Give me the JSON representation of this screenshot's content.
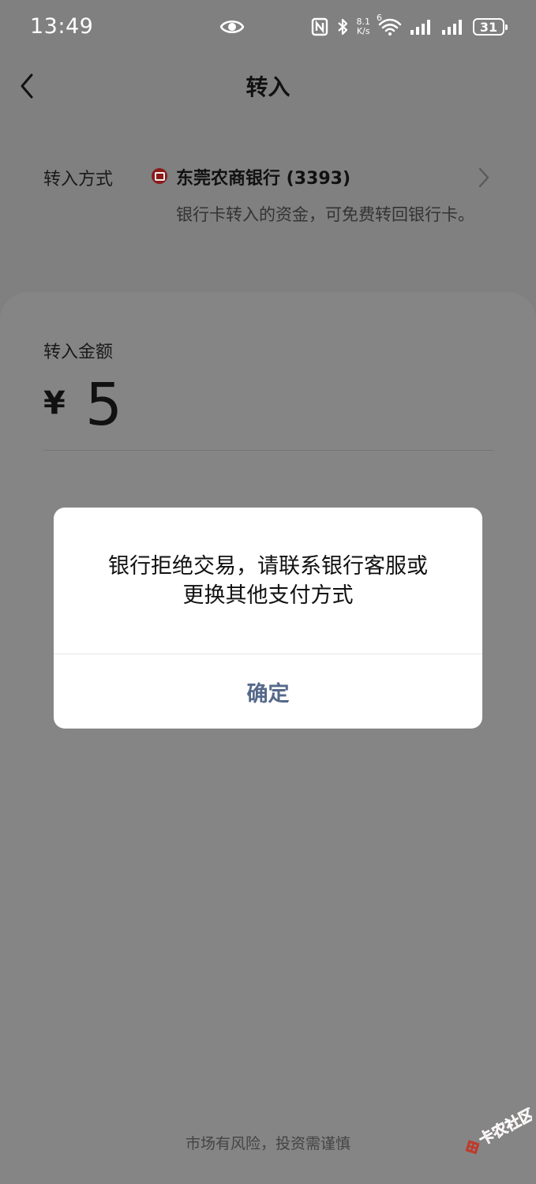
{
  "status_bar": {
    "time": "13:49",
    "net_speed_value": "8.1",
    "net_speed_unit": "K/s",
    "wifi_label": "6",
    "battery": "31"
  },
  "header": {
    "title": "转入"
  },
  "transfer_method": {
    "label": "转入方式",
    "bank_name": "东莞农商银行 (3393)",
    "hint": "银行卡转入的资金，可免费转回银行卡。",
    "bank_icon_color": "#8b1a1a"
  },
  "amount": {
    "label": "转入金额",
    "currency": "¥",
    "value": "5"
  },
  "dialog": {
    "message_line1": "银行拒绝交易，请联系银行客服或",
    "message_line2": "更换其他支付方式",
    "confirm_label": "确定",
    "confirm_color": "#55698a"
  },
  "footer": {
    "risk_notice": "市场有风险，投资需谨慎"
  },
  "watermark": {
    "text": "卡农社区"
  }
}
